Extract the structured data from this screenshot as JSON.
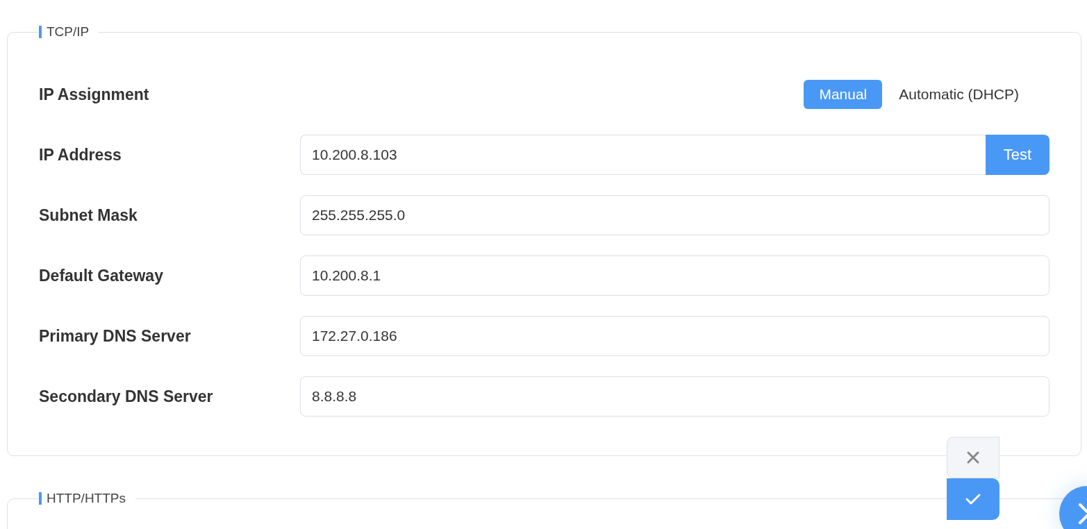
{
  "sections": [
    {
      "title": "TCP/IP",
      "rows": [
        {
          "kind": "toggle",
          "label": "IP Assignment",
          "options": [
            {
              "label": "Manual",
              "selected": true
            },
            {
              "label": "Automatic (DHCP)",
              "selected": false
            }
          ]
        },
        {
          "kind": "input",
          "label": "IP Address",
          "value": "10.200.8.103",
          "button": "Test"
        },
        {
          "kind": "input",
          "label": "Subnet Mask",
          "value": "255.255.255.0"
        },
        {
          "kind": "input",
          "label": "Default Gateway",
          "value": "10.200.8.1"
        },
        {
          "kind": "input",
          "label": "Primary DNS Server",
          "value": "172.27.0.186"
        },
        {
          "kind": "input",
          "label": "Secondary DNS Server",
          "value": "8.8.8.8"
        }
      ]
    },
    {
      "title": "HTTP/HTTPs"
    }
  ]
}
